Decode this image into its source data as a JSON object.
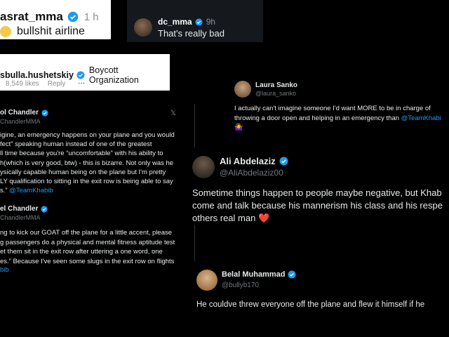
{
  "card1": {
    "username": "asrat_mma",
    "time": "1 h",
    "comment": "bullshit airline"
  },
  "card2": {
    "username": "dc_mma",
    "time": "9h",
    "comment": "That's really bad"
  },
  "card3": {
    "username": "sbulla.hushetskiy",
    "comment": "Boycott Organization",
    "likes": "8,549 likes",
    "reply": "Reply",
    "more": "•••"
  },
  "card4": {
    "name": "Laura Sanko",
    "handle": "@laura_sanko",
    "text": "I actually can't imagine someone I'd want MORE to be in charge of\nthrowing a door open and helping in an emergency than ",
    "mention": "@TeamKhabi",
    "emoji": "🤷‍♀️"
  },
  "card5": {
    "name": "ol Chandler",
    "handle": "ChandlerMMA",
    "x_logo": "𝕏",
    "text": "igine, an emergency happens on your plane and you would\nfect” speaking human instead of one of the greatest\nll time because you're “uncomfortable” with his ability to\nh(which is very good, btw) - this is bizarre. Not only was he\nysically capable human being on the plane but I'm pretty\nLY qualification to sitting in the exit row is being able to say\ns.” ",
    "mention": "@TeamKhabib"
  },
  "card6": {
    "name": "el Chandler",
    "handle": "ChandlerMMA",
    "text": "ng to kick our GOAT off the plane for a little accent, please\ng passengers do a physical and mental fitness aptitude test\net them sit in the exit row after uttering a one word, one\nes.” Because I've seen some slugs in the exit row on flights",
    "mention": "bib"
  },
  "card7": {
    "name": "Ali Abdelaziz",
    "handle": "@AliAbdelaziz00",
    "text": "Sometime things happen to people maybe negative, but Khab\ncome and talk because his mannerism his class and his respe\nothers real man ",
    "emoji": "❤️"
  },
  "card8": {
    "name": "Belal Muhammad",
    "handle": "@bullyb170",
    "text": "He couldve threw everyone off the plane and flew it himself  if he"
  },
  "colors": {
    "verified": "#1d9bf0",
    "mention": "#1d9bf0",
    "heart": "#e0245e"
  }
}
